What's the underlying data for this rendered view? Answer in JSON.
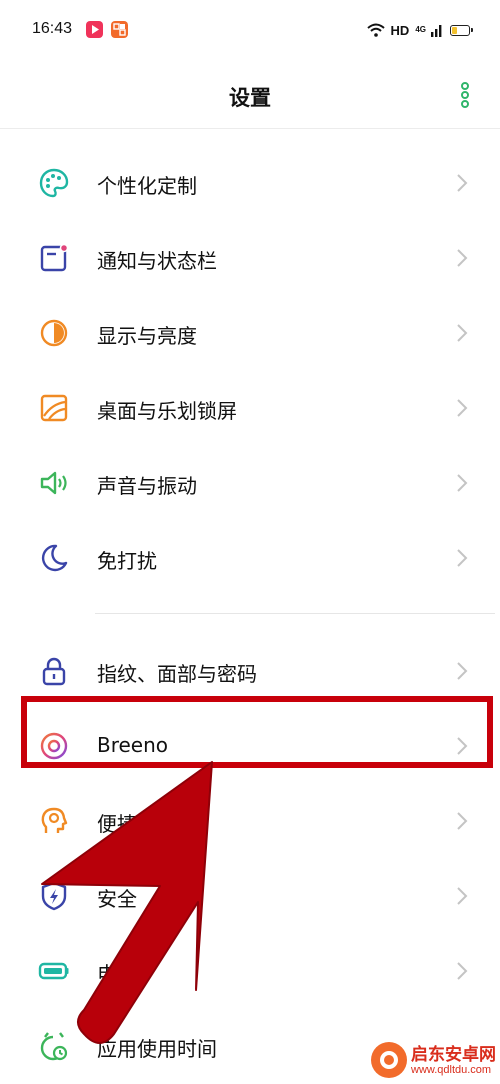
{
  "status_bar": {
    "time": "16:43",
    "hd": "HD",
    "network": "4G",
    "battery_level": 0.35,
    "icons": [
      "video-app-icon",
      "photo-app-icon",
      "wifi-icon",
      "signal-icon",
      "battery-icon"
    ]
  },
  "header": {
    "title": "设置",
    "more_icon": "more-vertical-icon"
  },
  "menu": {
    "items": [
      {
        "label": "个性化定制",
        "icon": "palette-icon"
      },
      {
        "label": "通知与状态栏",
        "icon": "notification-icon"
      },
      {
        "label": "显示与亮度",
        "icon": "brightness-icon"
      },
      {
        "label": "桌面与乐划锁屏",
        "icon": "wallpaper-icon"
      },
      {
        "label": "声音与振动",
        "icon": "speaker-icon"
      },
      {
        "label": "免打扰",
        "icon": "moon-icon"
      },
      {
        "label": "指纹、面部与密码",
        "icon": "lock-icon"
      },
      {
        "label": "Breeno",
        "icon": "breeno-icon"
      },
      {
        "label": "便捷辅助",
        "icon": "assist-icon"
      },
      {
        "label": "安全",
        "icon": "shield-icon"
      },
      {
        "label": "电池",
        "icon": "battery-icon"
      },
      {
        "label": "应用使用时间",
        "icon": "timer-icon"
      }
    ]
  },
  "watermark": {
    "text": "启东安卓网",
    "url": "www.qdltdu.com"
  },
  "colors": {
    "annotation_red": "#c8000a",
    "teal": "#1fb6a3",
    "orange": "#f08a24",
    "green": "#3cb55a",
    "indigo": "#3a44a8",
    "pink": "#e0457b"
  }
}
